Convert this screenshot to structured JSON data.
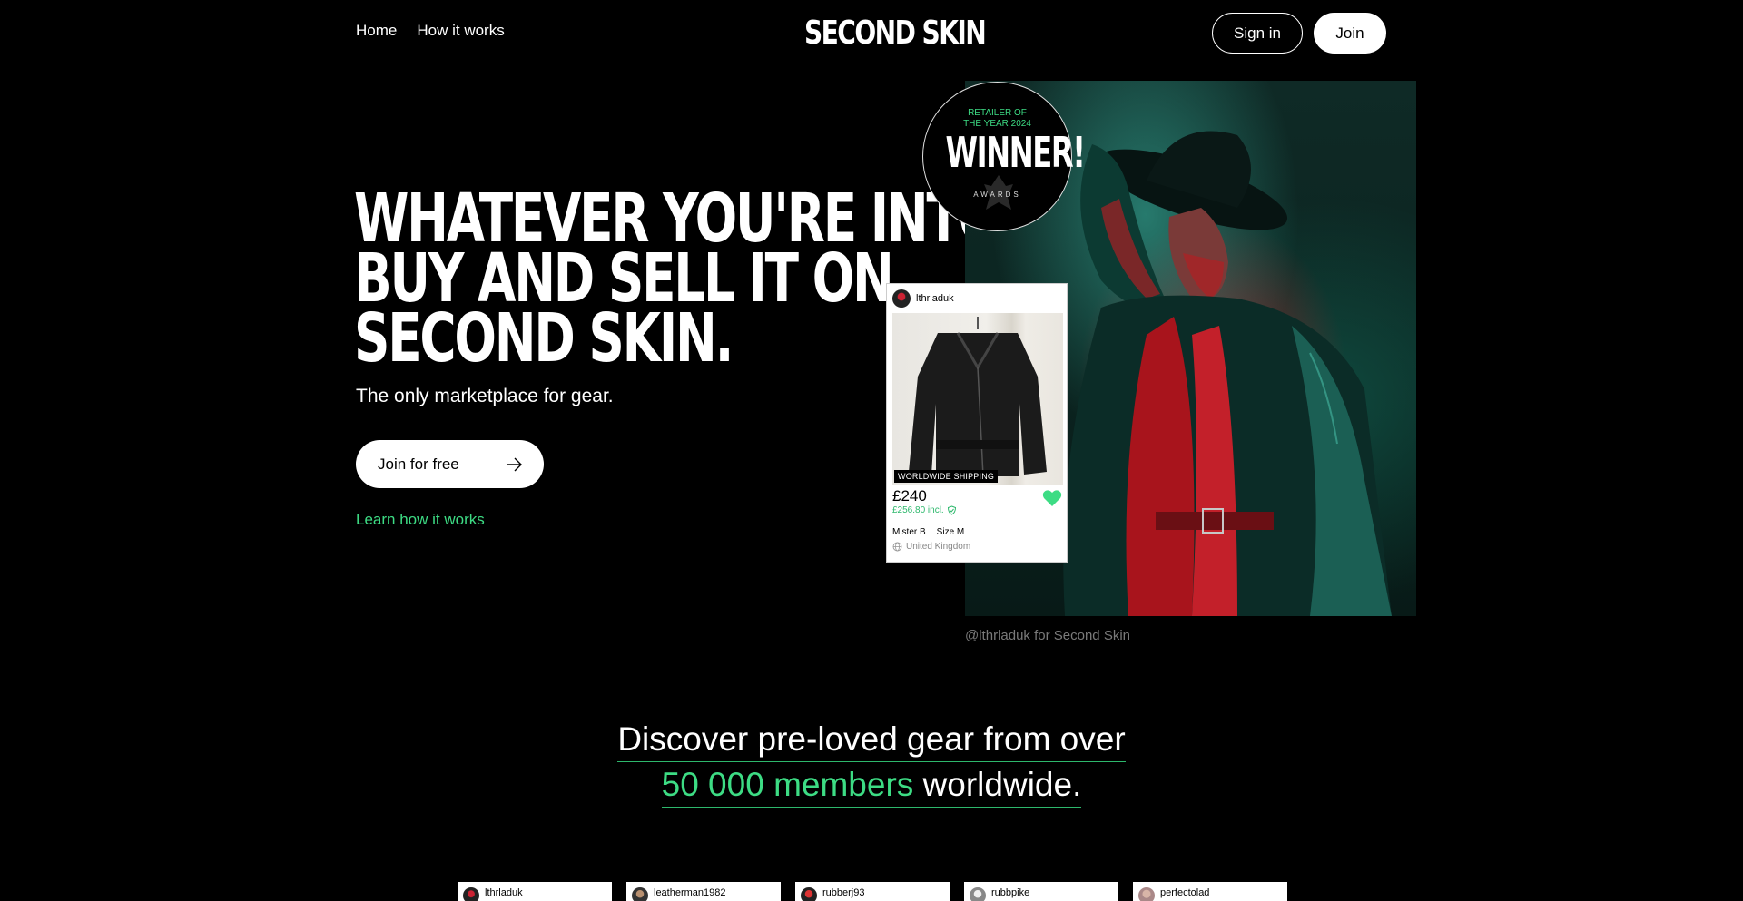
{
  "nav": {
    "links": [
      "Home",
      "How it works"
    ],
    "logo": "SECOND SKIN",
    "signin_label": "Sign in",
    "join_label": "Join"
  },
  "hero": {
    "headline": [
      "WHATEVER YOU'RE INTO,",
      "BUY AND SELL IT ON",
      "SECOND SKIN."
    ],
    "subline": "The only marketplace for gear.",
    "cta_label": "Join for free",
    "learn_label": "Learn how it works",
    "photo_credit_handle": "@lthrladuk",
    "photo_credit_suffix": " for Second Skin"
  },
  "badge": {
    "top_line1": "RETAILER OF",
    "top_line2": "THE YEAR 2024",
    "winner": "WINNER!",
    "awards": "AWARDS"
  },
  "listing": {
    "username": "lthrladuk",
    "shipping_tag": "WORLDWIDE SHIPPING",
    "price": "£240",
    "price_incl": "£256.80 incl.",
    "brand": "Mister B",
    "size": "Size M",
    "location": "United Kingdom",
    "favorited": true
  },
  "discover": {
    "line1": "Discover pre-loved gear from over",
    "members": "50 000 members",
    "suffix": " worldwide."
  },
  "member_cards": [
    {
      "username": "lthrladuk"
    },
    {
      "username": "leatherman1982"
    },
    {
      "username": "rubberj93"
    },
    {
      "username": "rubbpike"
    },
    {
      "username": "perfectolad"
    }
  ],
  "colors": {
    "accent": "#3ddc84",
    "background": "#000000",
    "text": "#ffffff"
  }
}
